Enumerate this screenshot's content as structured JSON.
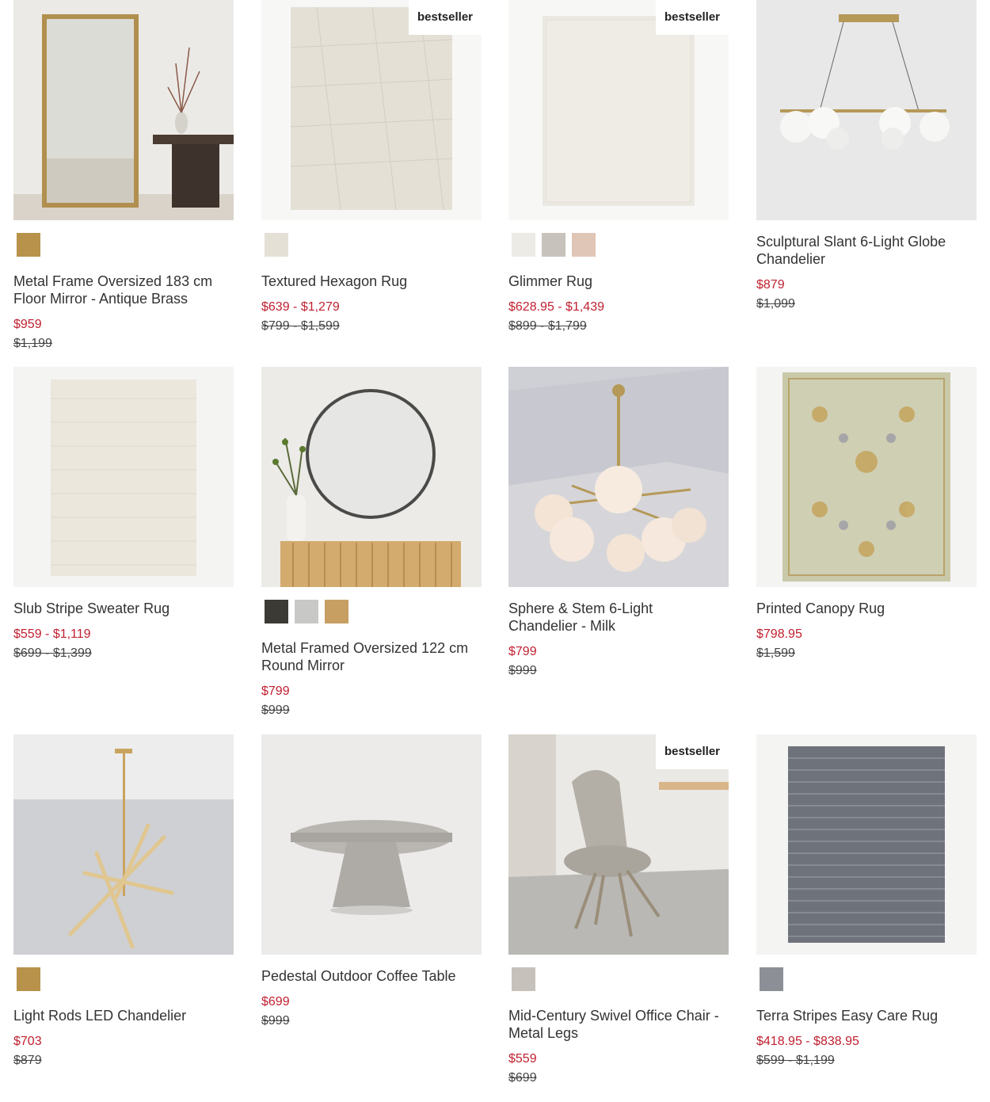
{
  "badge_text": "bestseller",
  "products": [
    {
      "title": "Metal Frame Oversized 183 cm Floor Mirror - Antique Brass",
      "sale": "$959",
      "orig": "$1,199",
      "badge": false,
      "swatches": [
        {
          "name": "antique-brass",
          "color": "#b8924a"
        }
      ]
    },
    {
      "title": "Textured Hexagon Rug",
      "sale": "$639 - $1,279",
      "orig": "$799 - $1,599",
      "badge": true,
      "swatches": [
        {
          "name": "ivory",
          "color": "#e4e0d6"
        }
      ]
    },
    {
      "title": "Glimmer Rug",
      "sale": "$628.95 - $1,439",
      "orig": "$899 - $1,799",
      "badge": true,
      "swatches": [
        {
          "name": "ivory",
          "color": "#ecebe6"
        },
        {
          "name": "gray",
          "color": "#c7c2bc"
        },
        {
          "name": "blush",
          "color": "#e0c6b6"
        }
      ]
    },
    {
      "title": "Sculptural Slant 6-Light Globe Chandelier",
      "sale": "$879",
      "orig": "$1,099",
      "badge": false,
      "swatches": []
    },
    {
      "title": "Slub Stripe Sweater Rug",
      "sale": "$559 - $1,119",
      "orig": "$699 - $1,399",
      "badge": false,
      "swatches": []
    },
    {
      "title": "Metal Framed Oversized 122 cm Round Mirror",
      "sale": "$799",
      "orig": "$999",
      "badge": false,
      "swatches": [
        {
          "name": "dark-bronze",
          "color": "#3b3a35"
        },
        {
          "name": "silver",
          "color": "#c8c8c6"
        },
        {
          "name": "brass",
          "color": "#c79f63"
        }
      ]
    },
    {
      "title": "Sphere & Stem 6-Light Chandelier - Milk",
      "sale": "$799",
      "orig": "$999",
      "badge": false,
      "swatches": []
    },
    {
      "title": "Printed Canopy Rug",
      "sale": "$798.95",
      "orig": "$1,599",
      "badge": false,
      "swatches": []
    },
    {
      "title": "Light Rods LED Chandelier",
      "sale": "$703",
      "orig": "$879",
      "badge": false,
      "swatches": [
        {
          "name": "brass",
          "color": "#b8924a"
        }
      ]
    },
    {
      "title": "Pedestal Outdoor Coffee Table",
      "sale": "$699",
      "orig": "$999",
      "badge": false,
      "swatches": []
    },
    {
      "title": "Mid-Century Swivel Office Chair - Metal Legs",
      "sale": "$559",
      "orig": "$699",
      "badge": true,
      "swatches": [
        {
          "name": "stone",
          "color": "#c6c2bb"
        }
      ]
    },
    {
      "title": "Terra Stripes Easy Care Rug",
      "sale": "$418.95 - $838.95",
      "orig": "$599 - $1,199",
      "badge": false,
      "swatches": [
        {
          "name": "slate",
          "color": "#8c9096"
        }
      ]
    }
  ]
}
